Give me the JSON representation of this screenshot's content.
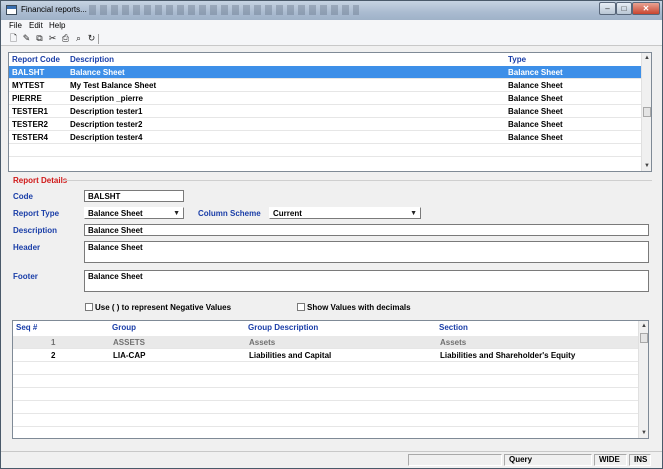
{
  "window": {
    "title": "Financial reports..."
  },
  "menu": [
    "File",
    "Edit",
    "Help"
  ],
  "toolbar": [
    {
      "icon": "new-document-icon"
    },
    {
      "icon": "edit-document-icon"
    },
    {
      "icon": "copy-icon"
    },
    {
      "icon": "cut-icon"
    },
    {
      "icon": "print-icon"
    },
    {
      "icon": "print-preview-icon"
    },
    {
      "icon": "refresh-icon"
    }
  ],
  "reports_grid": {
    "columns": [
      "Report Code",
      "Description",
      "Type"
    ],
    "rows": [
      {
        "code": "BALSHT",
        "description": "Balance Sheet",
        "type": "Balance Sheet",
        "selected": true
      },
      {
        "code": "MYTEST",
        "description": "My Test Balance Sheet",
        "type": "Balance Sheet"
      },
      {
        "code": "PIERRE",
        "description": "Description _pierre",
        "type": "Balance Sheet"
      },
      {
        "code": "TESTER1",
        "description": "Description tester1",
        "type": "Balance Sheet"
      },
      {
        "code": "TESTER2",
        "description": "Description tester2",
        "type": "Balance Sheet"
      },
      {
        "code": "TESTER4",
        "description": "Description tester4",
        "type": "Balance Sheet"
      }
    ]
  },
  "details": {
    "title": "Report Details",
    "code_label": "Code",
    "code_value": "BALSHT",
    "report_type_label": "Report Type",
    "report_type_value": "Balance Sheet",
    "column_scheme_label": "Column Scheme",
    "column_scheme_value": "Current",
    "description_label": "Description",
    "description_value": "Balance Sheet",
    "header_label": "Header",
    "header_value": "Balance Sheet",
    "footer_label": "Footer",
    "footer_value": "Balance Sheet",
    "negative_values_label": "Use ( ) to represent Negative Values",
    "decimals_label": "Show Values with decimals"
  },
  "groups_grid": {
    "columns": [
      "Seq #",
      "Group",
      "Group Description",
      "Section"
    ],
    "rows": [
      {
        "seq": "1",
        "group": "ASSETS",
        "description": "Assets",
        "section": "Assets"
      },
      {
        "seq": "2",
        "group": "LIA-CAP",
        "description": "Liabilities and Capital",
        "section": "Liabilities and Shareholder's Equity"
      }
    ]
  },
  "statusbar": {
    "mode": "Query",
    "width": "WIDE",
    "insert": "INS"
  }
}
